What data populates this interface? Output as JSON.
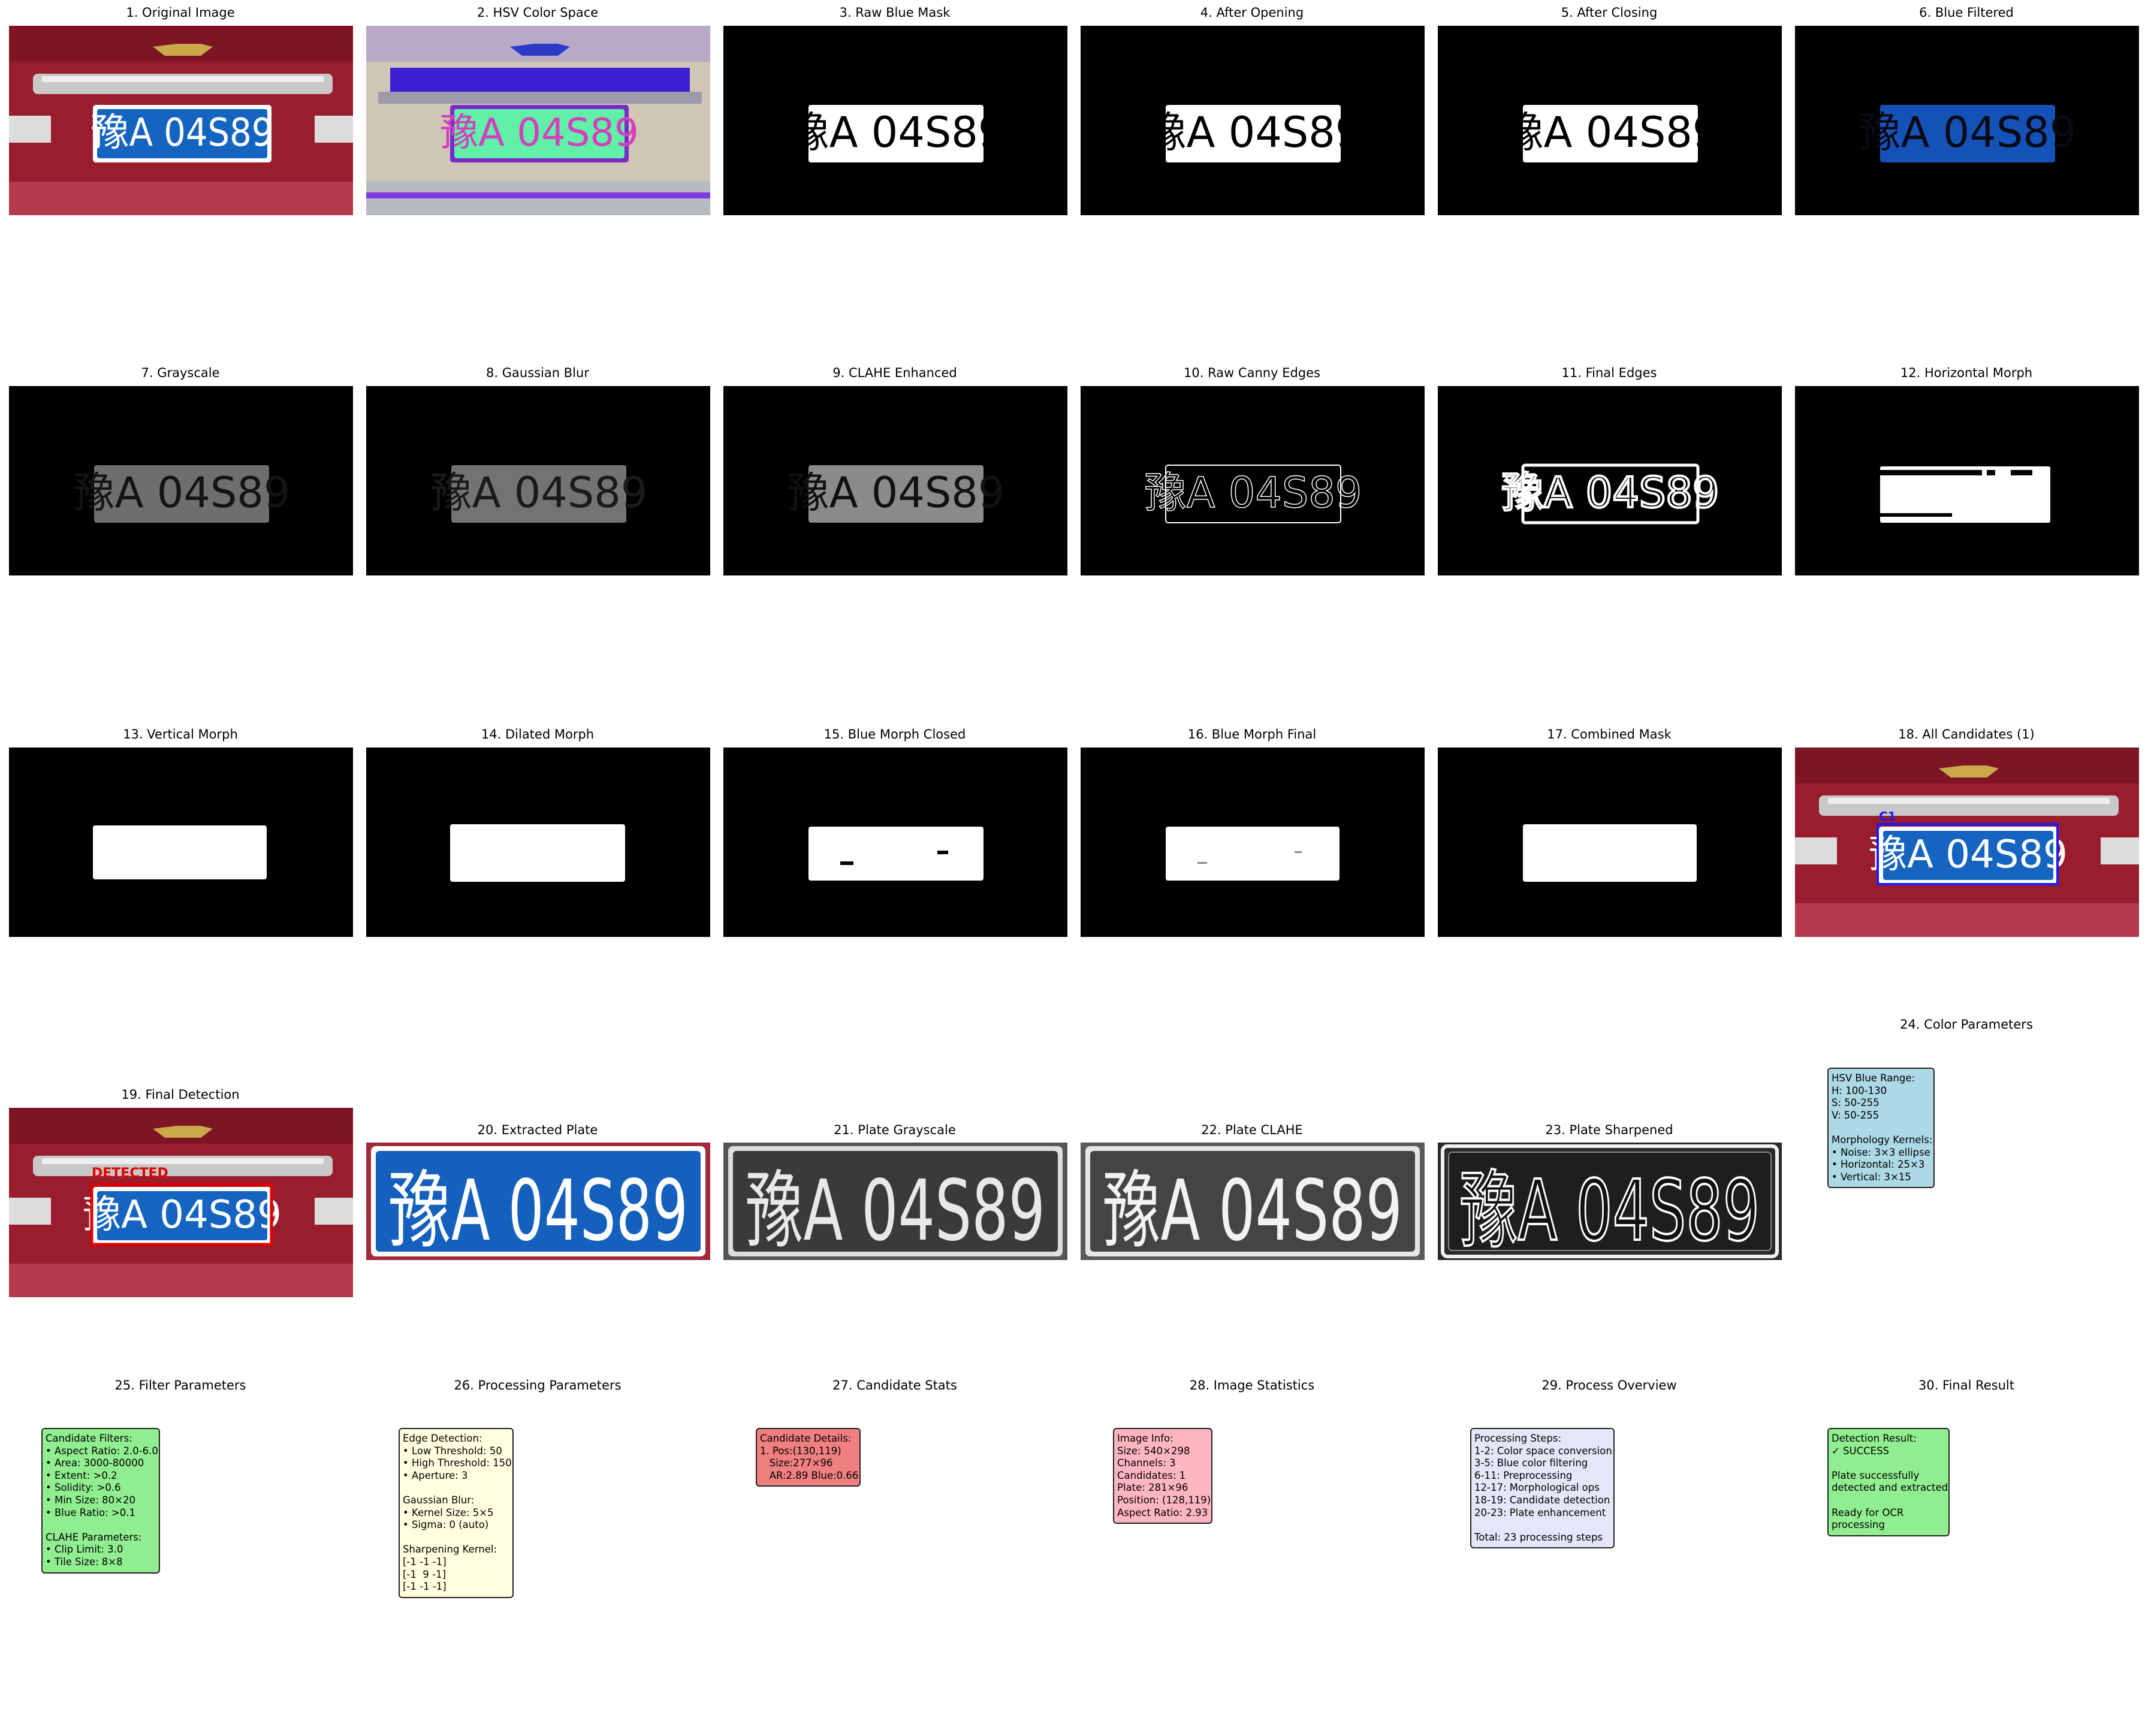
{
  "titles": {
    "t1": "1. Original Image",
    "t2": "2. HSV Color Space",
    "t3": "3. Raw Blue Mask",
    "t4": "4. After Opening",
    "t5": "5. After Closing",
    "t6": "6. Blue Filtered",
    "t7": "7. Grayscale",
    "t8": "8. Gaussian Blur",
    "t9": "9. CLAHE Enhanced",
    "t10": "10. Raw Canny Edges",
    "t11": "11. Final Edges",
    "t12": "12. Horizontal Morph",
    "t13": "13. Vertical Morph",
    "t14": "14. Dilated Morph",
    "t15": "15. Blue Morph Closed",
    "t16": "16. Blue Morph Final",
    "t17": "17. Combined Mask",
    "t18": "18. All Candidates (1)",
    "t19": "19. Final Detection",
    "t20": "20. Extracted Plate",
    "t21": "21. Plate Grayscale",
    "t22": "22. Plate CLAHE",
    "t23": "23. Plate Sharpened",
    "t24": "24. Color Parameters",
    "t25": "25. Filter Parameters",
    "t26": "26. Processing Parameters",
    "t27": "27. Candidate Stats",
    "t28": "28. Image Statistics",
    "t29": "29. Process Overview",
    "t30": "30. Final Result"
  },
  "plate_text": "豫A 04S89",
  "plate_text_cn": "豫",
  "plate_text_rest": "A 04S89",
  "labels": {
    "candidate": "C1",
    "detected": "DETECTED"
  },
  "boxes": {
    "color_params": "HSV Blue Range:\nH: 100-130\nS: 50-255\nV: 50-255\n\nMorphology Kernels:\n• Noise: 3×3 ellipse\n• Horizontal: 25×3\n• Vertical: 3×15",
    "filter_params": "Candidate Filters:\n• Aspect Ratio: 2.0-6.0\n• Area: 3000-80000\n• Extent: >0.2\n• Solidity: >0.6\n• Min Size: 80×20\n• Blue Ratio: >0.1\n\nCLAHE Parameters:\n• Clip Limit: 3.0\n• Tile Size: 8×8",
    "processing_params": "Edge Detection:\n• Low Threshold: 50\n• High Threshold: 150\n• Aperture: 3\n\nGaussian Blur:\n• Kernel Size: 5×5\n• Sigma: 0 (auto)\n\nSharpening Kernel:\n[-1 -1 -1]\n[-1  9 -1]\n[-1 -1 -1]",
    "candidate_stats": "Candidate Details:\n1. Pos:(130,119)\n   Size:277×96\n   AR:2.89 Blue:0.66",
    "image_stats": "Image Info:\nSize: 540×298\nChannels: 3\nCandidates: 1\nPlate: 281×96\nPosition: (128,119)\nAspect Ratio: 2.93",
    "process_overview": "Processing Steps:\n1-2: Color space conversion\n3-5: Blue color filtering\n6-11: Preprocessing\n12-17: Morphological ops\n18-19: Candidate detection\n20-23: Plate enhancement\n\nTotal: 23 processing steps",
    "final_result": "Detection Result:\n✓ SUCCESS\n\nPlate successfully\ndetected and extracted\n\nReady for OCR\nprocessing"
  },
  "colors": {
    "color_params_bg": "#add8e6",
    "filter_params_bg": "#90ee90",
    "processing_params_bg": "#ffffe0",
    "candidate_stats_bg": "#f08080",
    "image_stats_bg": "#ffb6c1",
    "process_overview_bg": "#e6e6fa",
    "final_result_bg": "#90ee90"
  }
}
